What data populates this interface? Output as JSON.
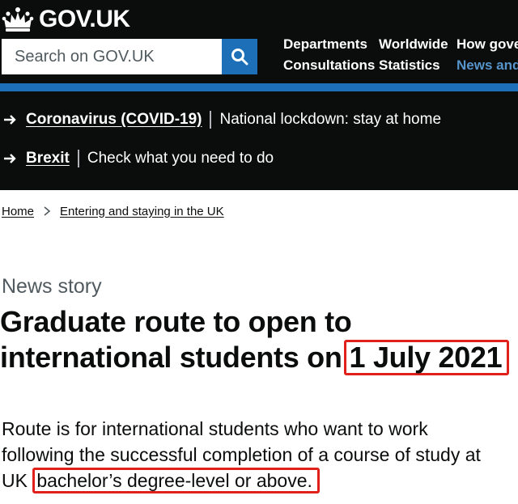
{
  "header": {
    "logo_text": "GOV.UK",
    "search": {
      "placeholder": "Search on GOV.UK"
    },
    "nav": [
      "Departments",
      "Worldwide",
      "How gove",
      "Consultations",
      "Statistics",
      "News and"
    ]
  },
  "banner": {
    "items": [
      {
        "link": "Coronavirus (COVID-19)",
        "text": "National lockdown: stay at home"
      },
      {
        "link": "Brexit",
        "text": "Check what you need to do"
      }
    ]
  },
  "breadcrumb": [
    "Home",
    "Entering and staying in the UK"
  ],
  "article": {
    "caption": "News story",
    "title_line1": "Graduate route to open to",
    "title_line2": "international students on",
    "title_date": "1 July 2021",
    "lede_line1": "Route is for international students who want to work",
    "lede_line2": "following the successful completion of a course of study at",
    "lede_line3_prefix": "UK",
    "lede_line3_highlight": "bachelor’s degree-level or above."
  },
  "colors": {
    "header_bg": "#0b0c0c",
    "brand_blue": "#1d70b8",
    "highlight_red": "#e0201b"
  }
}
